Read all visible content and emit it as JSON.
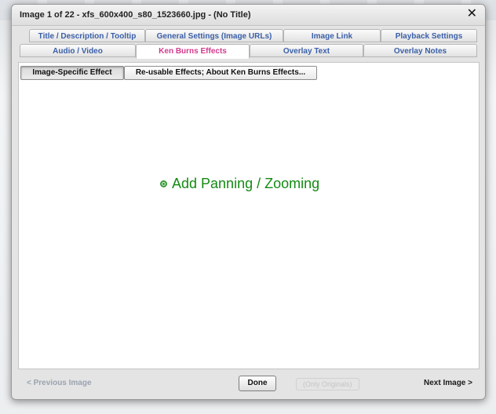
{
  "window": {
    "title": "Image 1 of 22 - xfs_600x400_s80_1523660.jpg - (No Title)",
    "close_glyph": "✕",
    "close_icon": "close-icon"
  },
  "tabs": {
    "row1": [
      {
        "label": "Title / Description / Tooltip"
      },
      {
        "label": "General Settings (Image URLs)"
      },
      {
        "label": "Image Link"
      },
      {
        "label": "Playback Settings"
      }
    ],
    "row2": [
      {
        "label": "Audio / Video"
      },
      {
        "label": "Ken Burns Effects",
        "active": true
      },
      {
        "label": "Overlay Text"
      },
      {
        "label": "Overlay Notes"
      }
    ]
  },
  "subtabs": [
    {
      "label": "Image-Specific Effect",
      "pressed": true
    },
    {
      "label": "Re-usable Effects; About Ken Burns Effects..."
    }
  ],
  "main": {
    "add_panning_label": "Add Panning / Zooming",
    "add_icon": "add-circle-icon"
  },
  "footer": {
    "prev_label": "< Previous Image",
    "done_label": "Done",
    "next_label": "Next Image >",
    "ghost_label": "(Only Originals)"
  },
  "colors": {
    "tab_text": "#3a5fa8",
    "tab_active_text": "#d33a8e",
    "add_link": "#138a13"
  }
}
